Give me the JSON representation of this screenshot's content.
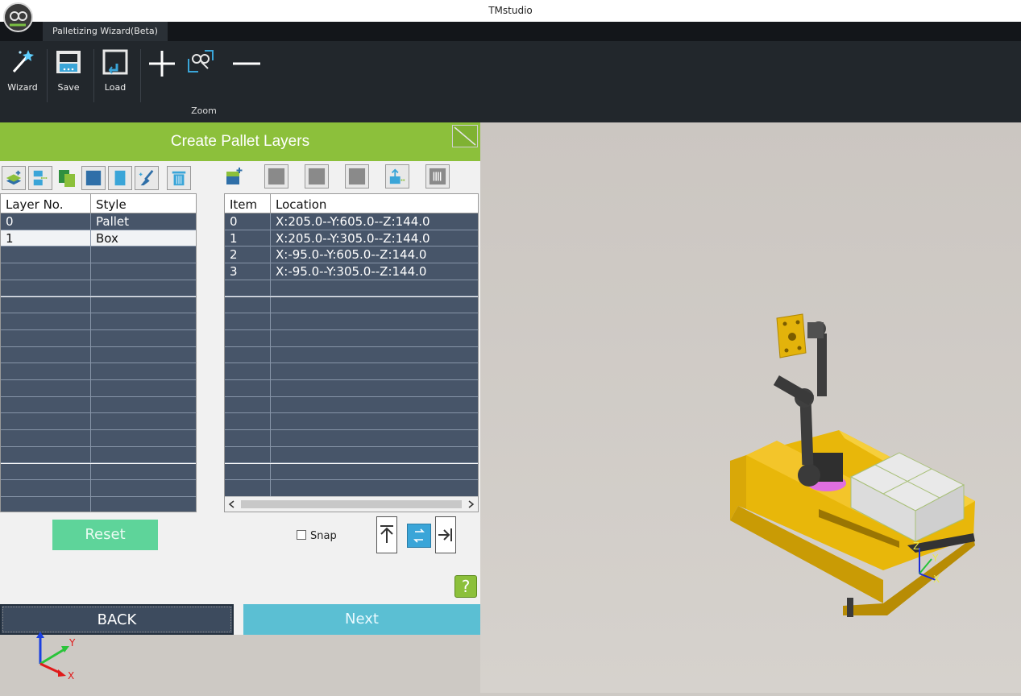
{
  "app": {
    "title": "TMstudio",
    "tab": "Palletizing Wizard(Beta)"
  },
  "toolbar": {
    "wizard_label": "Wizard",
    "save_label": "Save",
    "load_label": "Load",
    "zoom_group_label": "Zoom"
  },
  "panel": {
    "title": "Create Pallet Layers",
    "layers_table": {
      "headers": [
        "Layer No.",
        "Style"
      ],
      "rows": [
        {
          "layer": "0",
          "style": "Pallet"
        },
        {
          "layer": "1",
          "style": "Box"
        }
      ]
    },
    "items_table": {
      "headers": [
        "Item",
        "Location"
      ],
      "rows": [
        {
          "item": "0",
          "location": "X:205.0--Y:605.0--Z:144.0"
        },
        {
          "item": "1",
          "location": "X:205.0--Y:305.0--Z:144.0"
        },
        {
          "item": "2",
          "location": "X:-95.0--Y:605.0--Z:144.0"
        },
        {
          "item": "3",
          "location": "X:-95.0--Y:305.0--Z:144.0"
        }
      ]
    },
    "reset_label": "Reset",
    "snap_label": "Snap",
    "help_label": "?",
    "back_label": "BACK",
    "next_label": "Next"
  },
  "viewport": {
    "gizmo_x": "X",
    "gizmo_y": "Y",
    "model_axis_z": "Z",
    "model_axis_y": "Y",
    "model_axis_x": "X"
  },
  "colors": {
    "panel_header": "#8cc03b",
    "reset": "#5ed49a",
    "next": "#5bbfd3",
    "back": "#3d4b5e",
    "row_dark": "#475569",
    "pallet_yellow": "#e8b70a"
  }
}
